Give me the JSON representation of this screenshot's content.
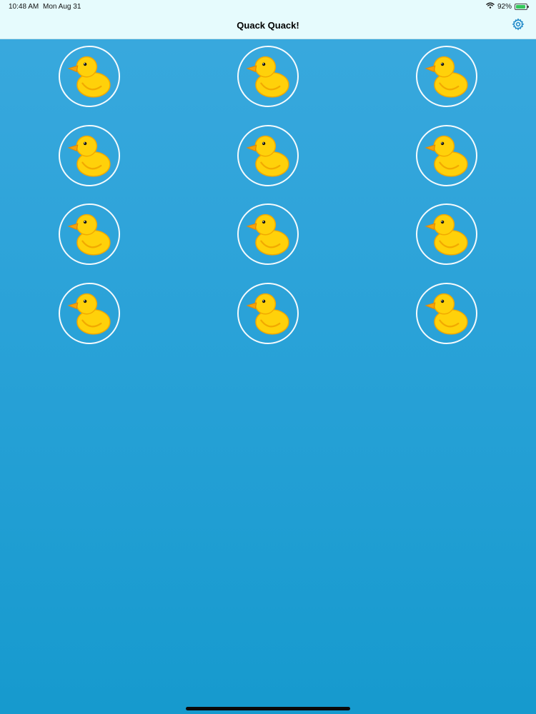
{
  "status_bar": {
    "time": "10:48 AM",
    "date": "Mon Aug 31",
    "battery_percent": "92%",
    "battery_level": 0.92,
    "wifi_icon": "wifi-icon"
  },
  "nav": {
    "title": "Quack Quack!",
    "settings_icon": "gear-icon"
  },
  "grid": {
    "columns": 3,
    "rows": 4,
    "button_icon": "duck-icon",
    "button_count": 12
  },
  "colors": {
    "nav_background": "#e6fbfd",
    "accent": "#1e88c8",
    "background_top": "#3aa9de",
    "background_bottom": "#169ace",
    "duck_body": "#ffd10a",
    "duck_beak": "#f4a20c"
  }
}
